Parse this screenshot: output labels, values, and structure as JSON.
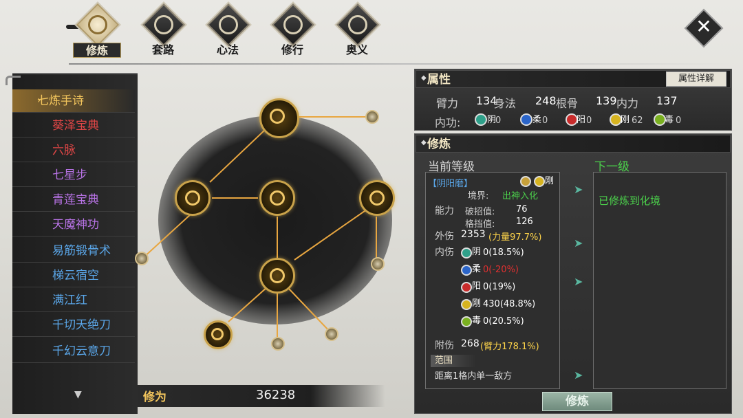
{
  "tabs": [
    {
      "label": "修炼",
      "icon": "cultivation-icon",
      "active": true
    },
    {
      "label": "套路",
      "icon": "routine-icon",
      "active": false
    },
    {
      "label": "心法",
      "icon": "mind-method-icon",
      "active": false
    },
    {
      "label": "修行",
      "icon": "practice-icon",
      "active": false
    },
    {
      "label": "奥义",
      "icon": "mystery-icon",
      "active": false
    }
  ],
  "sidebar": {
    "items": [
      {
        "label": "七炼手诗",
        "color": "#f1c45c",
        "selected": true
      },
      {
        "label": "葵泽宝典",
        "color": "#e04646"
      },
      {
        "label": "六脉",
        "color": "#e04646"
      },
      {
        "label": "七星步",
        "color": "#b873e6"
      },
      {
        "label": "青莲宝典",
        "color": "#b873e6"
      },
      {
        "label": "天魔神功",
        "color": "#b873e6"
      },
      {
        "label": "易筋锻骨术",
        "color": "#5aa6e8"
      },
      {
        "label": "梯云宿空",
        "color": "#5aa6e8"
      },
      {
        "label": "满江红",
        "color": "#5aa6e8"
      },
      {
        "label": "千切天绝刀",
        "color": "#5aa6e8"
      },
      {
        "label": "千幻云意刀",
        "color": "#5aa6e8"
      }
    ]
  },
  "cultivation_points": {
    "label": "修为",
    "value": "36238"
  },
  "attributes": {
    "title": "属性",
    "detail_button": "属性详解",
    "stats": [
      {
        "label": "臂力",
        "value": "134"
      },
      {
        "label": "身法",
        "value": "248"
      },
      {
        "label": "根骨",
        "value": "139"
      },
      {
        "label": "内力",
        "value": "137"
      }
    ],
    "internal_label": "内功:",
    "internal": [
      {
        "name": "阴",
        "value": "0",
        "color": "#2fa08a"
      },
      {
        "name": "柔",
        "value": "0",
        "color": "#2b65c9"
      },
      {
        "name": "阳",
        "value": "0",
        "color": "#c92b2b"
      },
      {
        "name": "刚",
        "value": "62",
        "color": "#d6b320"
      },
      {
        "name": "毒",
        "value": "0",
        "color": "#7ab020"
      }
    ]
  },
  "cultivate": {
    "title": "修炼",
    "current_label": "当前等级",
    "next_label": "下一级",
    "skill_name": "【阴阳磨】",
    "top_icons": [
      {
        "name": "刚",
        "color": "#d6b320"
      }
    ],
    "realm_label": "境界:",
    "realm_value": "出神入化",
    "ability_label": "能力",
    "ability": [
      {
        "label": "破招值:",
        "value": "76"
      },
      {
        "label": "格挡值:",
        "value": "126"
      }
    ],
    "outer_label": "外伤",
    "outer_value": "2353",
    "outer_extra": "(力量97.7%)",
    "inner_label": "内伤",
    "inner": [
      {
        "name": "阴",
        "value": "0(18.5%)",
        "color": "#2fa08a",
        "vcolor": "#ffffff"
      },
      {
        "name": "柔",
        "value": "0(-20%)",
        "color": "#2b65c9",
        "vcolor": "#e03030"
      },
      {
        "name": "阳",
        "value": "0(19%)",
        "color": "#c92b2b",
        "vcolor": "#ffffff"
      },
      {
        "name": "刚",
        "value": "430(48.8%)",
        "color": "#d6b320",
        "vcolor": "#ffffff"
      },
      {
        "name": "毒",
        "value": "0(20.5%)",
        "color": "#7ab020",
        "vcolor": "#ffffff"
      }
    ],
    "attach_label": "附伤",
    "attach_value": "268",
    "attach_extra": "(臂力178.1%)",
    "range_label": "范围",
    "range_value": "距离1格内单一敌方",
    "next_text": "已修炼到化境",
    "button_label": "修炼"
  }
}
